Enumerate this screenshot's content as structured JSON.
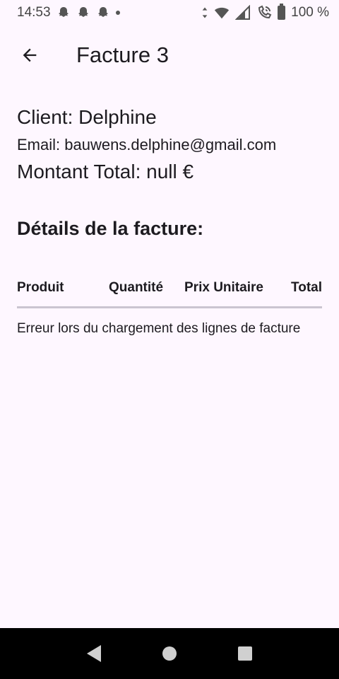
{
  "status_bar": {
    "time": "14:53",
    "battery": "100 %"
  },
  "app_bar": {
    "title": "Facture 3"
  },
  "invoice": {
    "client": "Client: Delphine",
    "email": "Email: bauwens.delphine@gmail.com",
    "total": "Montant Total: null €",
    "details_title": "Détails de la facture:"
  },
  "table": {
    "columns": [
      "Produit",
      "Quantité",
      "Prix Unitaire",
      "Total"
    ],
    "error": "Erreur lors du chargement des lignes de facture"
  },
  "colors": {
    "background": "#FEF7FF",
    "text": "#1D1B20",
    "divider": "#CAC4D0",
    "nav_bar": "#000000"
  }
}
